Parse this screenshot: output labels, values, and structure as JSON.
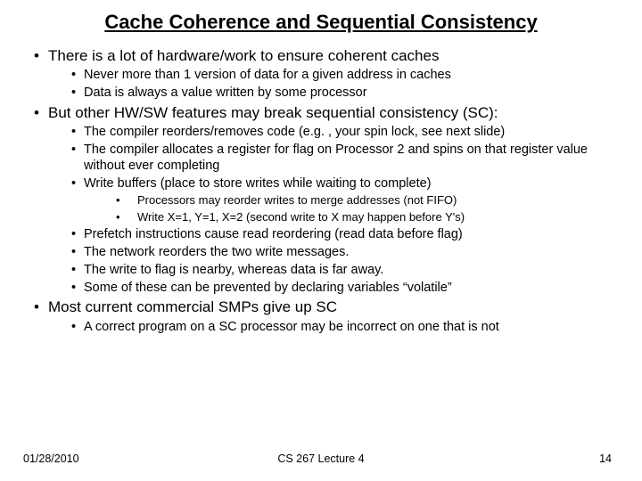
{
  "title": "Cache Coherence and Sequential Consistency",
  "b1": {
    "t": "There is a lot of hardware/work to ensure coherent caches",
    "s1": "Never more than 1 version of data for a given address in caches",
    "s2": "Data is always a value written by some processor"
  },
  "b2": {
    "t": "But other HW/SW features may break sequential consistency (SC):",
    "s1": "The compiler reorders/removes code (e.g. , your spin lock, see next slide)",
    "s2": "The compiler allocates a register for flag on Processor 2 and spins on that register value without ever completing",
    "s3": "Write buffers (place to store writes while waiting to complete)",
    "s3a": "Processors may reorder writes to merge addresses (not FIFO)",
    "s3b": "Write X=1, Y=1, X=2 (second write to X may happen before Y's)",
    "s4": "Prefetch instructions cause read reordering (read data before flag)",
    "s5": "The network reorders the two write messages.",
    "s6": " The write to flag is nearby, whereas data is far away.",
    "s7": "Some of these can be prevented by declaring variables “volatile”"
  },
  "b3": {
    "t": "Most current commercial SMPs give up SC",
    "s1": "A correct program on a SC processor may be incorrect on one that is not"
  },
  "footer": {
    "date": "01/28/2010",
    "center": "CS 267 Lecture 4",
    "pagenum": "14"
  },
  "bullet": "•"
}
